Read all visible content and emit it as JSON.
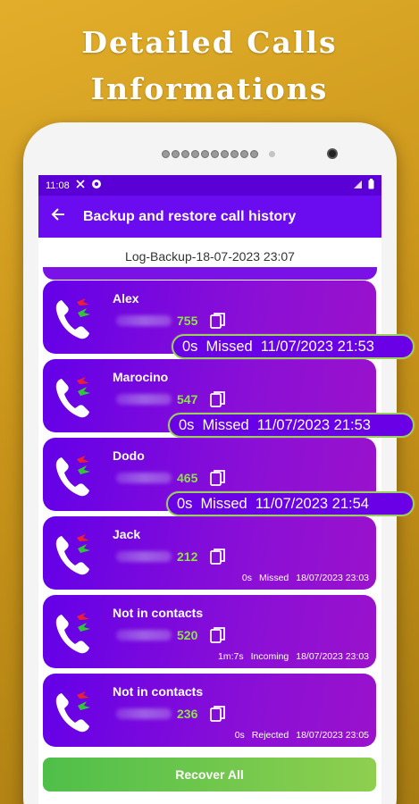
{
  "promo": {
    "line1": "Detailed Calls",
    "line2": "Informations"
  },
  "status_bar": {
    "time": "11:08"
  },
  "appbar": {
    "back_icon": "arrow-left-icon",
    "title": "Backup and restore call history"
  },
  "backup_name": "Log-Backup-18-07-2023 23:07",
  "calls": [
    {
      "name": "Alex",
      "number_suffix": "755",
      "duration": "0s",
      "type": "Missed",
      "datetime": "11/07/2023 21:53"
    },
    {
      "name": "Marocino",
      "number_suffix": "547",
      "duration": "0s",
      "type": "Missed",
      "datetime": "11/07/2023 21:53"
    },
    {
      "name": "Dodo",
      "number_suffix": "465",
      "duration": "0s",
      "type": "Missed",
      "datetime": "11/07/2023 21:54"
    },
    {
      "name": "Jack",
      "number_suffix": "212",
      "duration": "0s",
      "type": "Missed",
      "datetime": "18/07/2023 23:03"
    },
    {
      "name": "Not in contacts",
      "number_suffix": "520",
      "duration": "1m:7s",
      "type": "Incoming",
      "datetime": "18/07/2023 23:03"
    },
    {
      "name": "Not in contacts",
      "number_suffix": "236",
      "duration": "0s",
      "type": "Rejected",
      "datetime": "18/07/2023 23:05"
    }
  ],
  "recover_label": "Recover All",
  "colors": {
    "card": "#6a00e6",
    "accent_green": "#8fe04a",
    "appbar": "#6a0bf0"
  }
}
